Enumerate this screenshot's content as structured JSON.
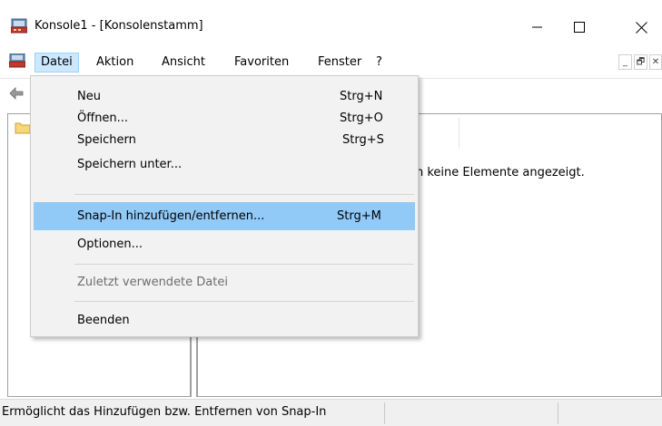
{
  "window": {
    "title": "Konsole1 - [Konsolenstamm]",
    "controls": {
      "minimize": "—",
      "maximize": "☐",
      "close": "✕"
    }
  },
  "menubar": {
    "items": [
      {
        "label": "Datei",
        "active": true
      },
      {
        "label": "Aktion"
      },
      {
        "label": "Ansicht"
      },
      {
        "label": "Favoriten"
      },
      {
        "label": "Fenster"
      },
      {
        "label": "?"
      }
    ],
    "mdi_controls": {
      "minimize": "_",
      "restore": "🗗",
      "close": "✕"
    }
  },
  "content": {
    "empty_message": "n keine Elemente angezeigt."
  },
  "statusbar": {
    "text": "Ermöglicht das Hinzufügen bzw. Entfernen von Snap-In"
  },
  "file_menu": {
    "items": [
      {
        "label": "Neu",
        "shortcut": "Strg+N"
      },
      {
        "label": "Öffnen...",
        "shortcut": "Strg+O"
      },
      {
        "label": "Speichern",
        "shortcut": "Strg+S"
      },
      {
        "label": "Speichern unter...",
        "shortcut": ""
      },
      {
        "label": "Snap-In hinzufügen/entfernen...",
        "shortcut": "Strg+M",
        "highlighted": true
      },
      {
        "label": "Optionen...",
        "shortcut": ""
      },
      {
        "label": "Zuletzt verwendete Datei",
        "shortcut": "",
        "disabled": true
      },
      {
        "label": "Beenden",
        "shortcut": ""
      }
    ]
  },
  "colors": {
    "menu_highlight": "#91c9f7",
    "menubar_active": "#cce8ff",
    "menu_background": "#f2f2f2",
    "disabled_text": "#6d6d6d"
  },
  "icons": [
    "mmc-console-icon",
    "document-icon",
    "back-arrow-icon",
    "folder-icon"
  ]
}
